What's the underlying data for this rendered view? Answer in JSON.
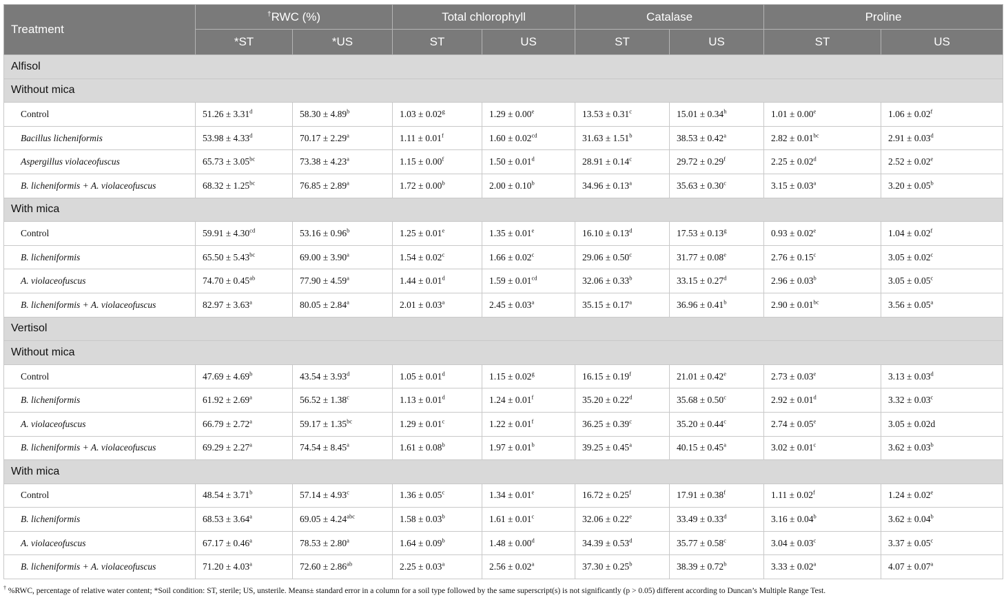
{
  "header": {
    "treatment": "Treatment",
    "groups": [
      {
        "dagger": "†",
        "label": "RWC (%)"
      },
      {
        "dagger": "",
        "label": "Total chlorophyll"
      },
      {
        "dagger": "",
        "label": "Catalase"
      },
      {
        "dagger": "",
        "label": "Proline"
      }
    ],
    "subs": [
      "*ST",
      "*US",
      "ST",
      "US",
      "ST",
      "US",
      "ST",
      "US"
    ]
  },
  "rows": [
    {
      "type": "section",
      "label": "Alfisol"
    },
    {
      "type": "section",
      "label": "Without mica"
    },
    {
      "type": "data",
      "treatment": "Control",
      "italic": false,
      "cells": [
        [
          "51.26 ± 3.31",
          "d"
        ],
        [
          "58.30 ± 4.89",
          "b"
        ],
        [
          "1.03 ± 0.02",
          "g"
        ],
        [
          "1.29 ± 0.00",
          "e"
        ],
        [
          "13.53 ± 0.31",
          "c"
        ],
        [
          "15.01 ± 0.34",
          "h"
        ],
        [
          "1.01 ± 0.00",
          "e"
        ],
        [
          "1.06 ± 0.02",
          "f"
        ]
      ]
    },
    {
      "type": "data",
      "treatment": "Bacillus licheniformis",
      "italic": true,
      "cells": [
        [
          "53.98 ± 4.33",
          "d"
        ],
        [
          "70.17 ± 2.29",
          "a"
        ],
        [
          "1.11 ± 0.01",
          "f"
        ],
        [
          "1.60 ± 0.02",
          "cd"
        ],
        [
          "31.63 ± 1.51",
          "b"
        ],
        [
          "38.53 ± 0.42",
          "a"
        ],
        [
          "2.82 ± 0.01",
          "bc"
        ],
        [
          "2.91 ± 0.03",
          "d"
        ]
      ]
    },
    {
      "type": "data",
      "treatment": "Aspergillus violaceofuscus",
      "italic": true,
      "cells": [
        [
          "65.73 ± 3.05",
          "bc"
        ],
        [
          "73.38 ± 4.23",
          "a"
        ],
        [
          "1.15 ± 0.00",
          "f"
        ],
        [
          "1.50 ± 0.01",
          "d"
        ],
        [
          "28.91 ± 0.14",
          "c"
        ],
        [
          "29.72 ± 0.29",
          "f"
        ],
        [
          "2.25 ± 0.02",
          "d"
        ],
        [
          "2.52 ± 0.02",
          "e"
        ]
      ]
    },
    {
      "type": "data",
      "treatment": "B. licheniformis + A. violaceofuscus",
      "italic": true,
      "cells": [
        [
          "68.32 ± 1.25",
          "bc"
        ],
        [
          "76.85 ± 2.89",
          "a"
        ],
        [
          "1.72 ± 0.00",
          "b"
        ],
        [
          "2.00 ± 0.10",
          "b"
        ],
        [
          "34.96 ± 0.13",
          "a"
        ],
        [
          "35.63 ± 0.30",
          "c"
        ],
        [
          "3.15 ± 0.03",
          "a"
        ],
        [
          "3.20 ± 0.05",
          "b"
        ]
      ]
    },
    {
      "type": "section",
      "label": "With mica"
    },
    {
      "type": "data",
      "treatment": "Control",
      "italic": false,
      "cells": [
        [
          "59.91 ± 4.30",
          "cd"
        ],
        [
          "53.16 ± 0.96",
          "b"
        ],
        [
          "1.25 ± 0.01",
          "e"
        ],
        [
          "1.35 ± 0.01",
          "e"
        ],
        [
          "16.10 ± 0.13",
          "d"
        ],
        [
          "17.53 ± 0.13",
          "g"
        ],
        [
          "0.93 ± 0.02",
          "e"
        ],
        [
          "1.04 ± 0.02",
          "f"
        ]
      ]
    },
    {
      "type": "data",
      "treatment": "B. licheniformis",
      "italic": true,
      "cells": [
        [
          "65.50 ± 5.43",
          "bc"
        ],
        [
          "69.00 ± 3.90",
          "a"
        ],
        [
          "1.54 ± 0.02",
          "c"
        ],
        [
          "1.66 ± 0.02",
          "c"
        ],
        [
          "29.06 ± 0.50",
          "c"
        ],
        [
          "31.77 ± 0.08",
          "e"
        ],
        [
          "2.76 ± 0.15",
          "c"
        ],
        [
          "3.05 ± 0.02",
          "c"
        ]
      ]
    },
    {
      "type": "data",
      "treatment": "A. violaceofuscus",
      "italic": true,
      "cells": [
        [
          "74.70 ± 0.45",
          "ab"
        ],
        [
          "77.90 ± 4.59",
          "a"
        ],
        [
          "1.44 ± 0.01",
          "d"
        ],
        [
          "1.59 ± 0.01",
          "cd"
        ],
        [
          "32.06 ± 0.33",
          "b"
        ],
        [
          "33.15 ± 0.27",
          "d"
        ],
        [
          "2.96 ± 0.03",
          "b"
        ],
        [
          "3.05 ± 0.05",
          "c"
        ]
      ]
    },
    {
      "type": "data",
      "treatment": "B. licheniformis + A. violaceofuscus",
      "italic": true,
      "cells": [
        [
          "82.97 ± 3.63",
          "a"
        ],
        [
          "80.05 ± 2.84",
          "a"
        ],
        [
          "2.01 ± 0.03",
          "a"
        ],
        [
          "2.45 ± 0.03",
          "a"
        ],
        [
          "35.15 ± 0.17",
          "a"
        ],
        [
          "36.96 ± 0.41",
          "b"
        ],
        [
          "2.90 ± 0.01",
          "bc"
        ],
        [
          "3.56 ± 0.05",
          "a"
        ]
      ]
    },
    {
      "type": "section",
      "label": "Vertisol"
    },
    {
      "type": "section",
      "label": "Without mica"
    },
    {
      "type": "data",
      "treatment": "Control",
      "italic": false,
      "cells": [
        [
          "47.69 ± 4.69",
          "b"
        ],
        [
          "43.54 ± 3.93",
          "d"
        ],
        [
          "1.05 ± 0.01",
          "d"
        ],
        [
          "1.15 ± 0.02",
          "g"
        ],
        [
          "16.15 ± 0.19",
          "f"
        ],
        [
          "21.01 ± 0.42",
          "e"
        ],
        [
          "2.73 ± 0.03",
          "e"
        ],
        [
          "3.13 ± 0.03",
          "d"
        ]
      ]
    },
    {
      "type": "data",
      "treatment": "B. licheniformis",
      "italic": true,
      "cells": [
        [
          "61.92 ± 2.69",
          "a"
        ],
        [
          "56.52 ± 1.38",
          "c"
        ],
        [
          "1.13 ± 0.01",
          "d"
        ],
        [
          "1.24 ± 0.01",
          "f"
        ],
        [
          "35.20 ± 0.22",
          "d"
        ],
        [
          "35.68 ± 0.50",
          "c"
        ],
        [
          "2.92 ± 0.01",
          "d"
        ],
        [
          "3.32 ± 0.03",
          "c"
        ]
      ]
    },
    {
      "type": "data",
      "treatment": "A. violaceofuscus",
      "italic": true,
      "cells": [
        [
          "66.79 ± 2.72",
          "a"
        ],
        [
          "59.17 ± 1.35",
          "bc"
        ],
        [
          "1.29 ± 0.01",
          "c"
        ],
        [
          "1.22 ± 0.01",
          "f"
        ],
        [
          "36.25 ± 0.39",
          "c"
        ],
        [
          "35.20 ± 0.44",
          "c"
        ],
        [
          "2.74 ± 0.05",
          "e"
        ],
        [
          "3.05 ± 0.02d",
          ""
        ]
      ]
    },
    {
      "type": "data",
      "treatment": "B. licheniformis + A. violaceofuscus",
      "italic": true,
      "cells": [
        [
          "69.29 ± 2.27",
          "a"
        ],
        [
          "74.54 ± 8.45",
          "a"
        ],
        [
          "1.61 ± 0.08",
          "b"
        ],
        [
          "1.97 ± 0.01",
          "b"
        ],
        [
          "39.25 ± 0.45",
          "a"
        ],
        [
          "40.15 ± 0.45",
          "a"
        ],
        [
          "3.02 ± 0.01",
          "c"
        ],
        [
          "3.62 ± 0.03",
          "b"
        ]
      ]
    },
    {
      "type": "section",
      "label": "With mica"
    },
    {
      "type": "data",
      "treatment": "Control",
      "italic": false,
      "cells": [
        [
          "48.54 ± 3.71",
          "b"
        ],
        [
          "57.14 ± 4.93",
          "c"
        ],
        [
          "1.36 ± 0.05",
          "c"
        ],
        [
          "1.34 ± 0.01",
          "e"
        ],
        [
          "16.72 ± 0.25",
          "f"
        ],
        [
          "17.91 ± 0.38",
          "f"
        ],
        [
          "1.11 ± 0.02",
          "f"
        ],
        [
          "1.24 ± 0.02",
          "e"
        ]
      ]
    },
    {
      "type": "data",
      "treatment": "B. licheniformis",
      "italic": true,
      "cells": [
        [
          "68.53 ± 3.64",
          "a"
        ],
        [
          "69.05 ± 4.24",
          "abc"
        ],
        [
          "1.58 ± 0.03",
          "b"
        ],
        [
          "1.61 ± 0.01",
          "c"
        ],
        [
          "32.06 ± 0.22",
          "e"
        ],
        [
          "33.49 ± 0.33",
          "d"
        ],
        [
          "3.16 ± 0.04",
          "b"
        ],
        [
          "3.62 ± 0.04",
          "b"
        ]
      ]
    },
    {
      "type": "data",
      "treatment": "A. violaceofuscus",
      "italic": true,
      "cells": [
        [
          "67.17 ± 0.46",
          "a"
        ],
        [
          "78.53 ± 2.80",
          "a"
        ],
        [
          "1.64 ± 0.09",
          "b"
        ],
        [
          "1.48 ± 0.00",
          "d"
        ],
        [
          "34.39 ± 0.53",
          "d"
        ],
        [
          "35.77 ± 0.58",
          "c"
        ],
        [
          "3.04 ± 0.03",
          "c"
        ],
        [
          "3.37 ± 0.05",
          "c"
        ]
      ]
    },
    {
      "type": "data",
      "treatment": "B. licheniformis + A. violaceofuscus",
      "italic": true,
      "cells": [
        [
          "71.20 ± 4.03",
          "a"
        ],
        [
          "72.60 ± 2.86",
          "ab"
        ],
        [
          "2.25 ± 0.03",
          "a"
        ],
        [
          "2.56 ± 0.02",
          "a"
        ],
        [
          "37.30 ± 0.25",
          "b"
        ],
        [
          "38.39 ± 0.72",
          "b"
        ],
        [
          "3.33 ± 0.02",
          "a"
        ],
        [
          "4.07 ± 0.07",
          "a"
        ]
      ]
    }
  ],
  "footnote": {
    "dagger": "†",
    "text": " %RWC, percentage of relative water content; *Soil condition: ST, sterile; US, unsterile. Means± standard error in a column for a soil type followed by the same superscript(s) is not significantly (p > 0.05) different according to Duncan’s Multiple Range Test."
  },
  "colors": {
    "header_bg": "#7a7a7a",
    "section_bg": "#d9d9d9"
  }
}
